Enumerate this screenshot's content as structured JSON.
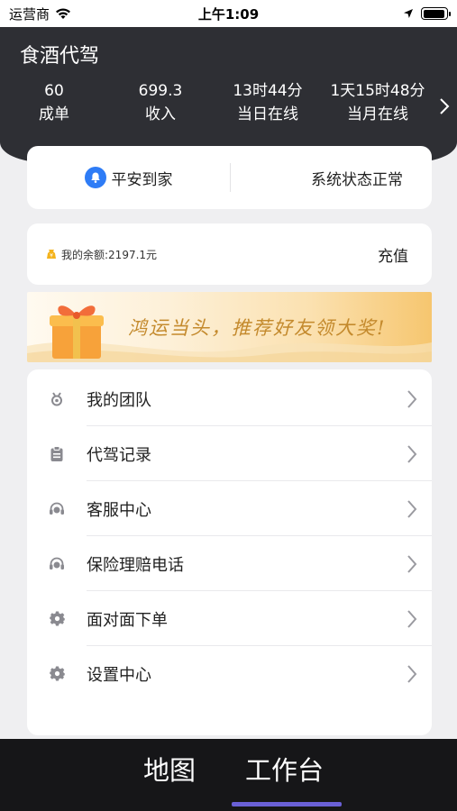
{
  "status_bar": {
    "carrier": "运营商",
    "time": "上午1:09",
    "battery_level": 0.95
  },
  "header": {
    "app_title": "食酒代驾",
    "stats": [
      {
        "value": "60",
        "label": "成单"
      },
      {
        "value": "699.3",
        "label": "收入"
      },
      {
        "value": "13时44分",
        "label": "当日在线"
      },
      {
        "value": "1天15时48分",
        "label": "当月在线"
      }
    ],
    "more_icon": "chevron-right-icon"
  },
  "safety": {
    "left_label": "平安到家",
    "right_label": "系统状态正常",
    "icon": "bell-icon"
  },
  "balance": {
    "text": "我的余额:2197.1元",
    "recharge_label": "充值",
    "icon": "coin-icon"
  },
  "banner": {
    "text": "鸿运当头，推荐好友领大奖!",
    "icon": "gift-icon"
  },
  "menu": {
    "items": [
      {
        "label": "我的团队",
        "icon": "team-icon"
      },
      {
        "label": "代驾记录",
        "icon": "clipboard-icon"
      },
      {
        "label": "客服中心",
        "icon": "headset-icon"
      },
      {
        "label": "保险理赔电话",
        "icon": "headset-icon"
      },
      {
        "label": "面对面下单",
        "icon": "gear-icon"
      },
      {
        "label": "设置中心",
        "icon": "gear-icon"
      }
    ]
  },
  "tabbar": {
    "tabs": [
      {
        "label": "地图"
      },
      {
        "label": "工作台"
      }
    ],
    "active_index": 1,
    "indicator_color": "#6a60d6"
  },
  "colors": {
    "header_bg": "#2e2f34",
    "accent_blue": "#2e7cf6",
    "banner_text": "#c48a2d"
  }
}
